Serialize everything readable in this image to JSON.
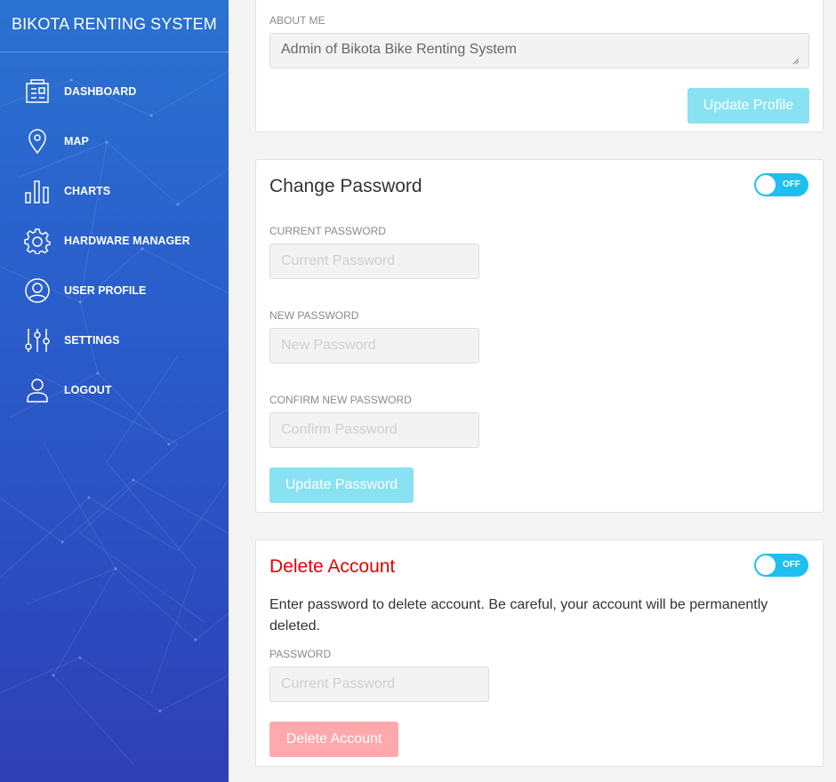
{
  "sidebar": {
    "brand": "BIKOTA RENTING SYSTEM",
    "items": [
      {
        "label": "DASHBOARD",
        "icon": "dashboard-icon"
      },
      {
        "label": "MAP",
        "icon": "map-pin-icon"
      },
      {
        "label": "CHARTS",
        "icon": "bar-chart-icon"
      },
      {
        "label": "HARDWARE MANAGER",
        "icon": "gear-icon"
      },
      {
        "label": "USER PROFILE",
        "icon": "user-circle-icon"
      },
      {
        "label": "SETTINGS",
        "icon": "sliders-icon"
      },
      {
        "label": "LOGOUT",
        "icon": "user-icon"
      }
    ],
    "gradient": [
      "#2a72d0",
      "#2f3fb5"
    ]
  },
  "about": {
    "label": "ABOUT ME",
    "value": "Admin of Bikota Bike Renting System",
    "button": "Update Profile"
  },
  "change_password": {
    "title": "Change Password",
    "toggle": "OFF",
    "current_label": "CURRENT PASSWORD",
    "current_placeholder": "Current Password",
    "new_label": "NEW PASSWORD",
    "new_placeholder": "New Password",
    "confirm_label": "CONFIRM NEW PASSWORD",
    "confirm_placeholder": "Confirm Password",
    "button": "Update Password"
  },
  "delete_account": {
    "title": "Delete Account",
    "toggle": "OFF",
    "warning": "Enter password to delete account. Be careful, your account will be permanently deleted.",
    "password_label": "PASSWORD",
    "password_placeholder": "Current Password",
    "button": "Delete Account"
  },
  "colors": {
    "accent_cyan": "#89e2f2",
    "toggle_blue": "#1ebff0",
    "danger_red": "#e60000",
    "danger_pink": "#ffa9ad"
  }
}
